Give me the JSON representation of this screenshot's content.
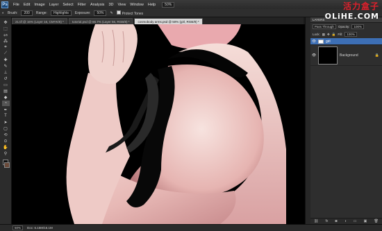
{
  "menu": {
    "logo": "Ps",
    "items": [
      "File",
      "Edit",
      "Image",
      "Layer",
      "Select",
      "Filter",
      "Analysis",
      "3D",
      "View",
      "Window",
      "Help"
    ],
    "zoom": "50%"
  },
  "options": {
    "brush_label": "Brush:",
    "brush_size": "200",
    "range_label": "Range:",
    "range_value": "Highlights",
    "exposure_label": "Exposure:",
    "exposure_value": "50%",
    "protect_tones": "Protect Tones"
  },
  "logo": {
    "cn": "活力盒子",
    "en": "OLiHE.COM"
  },
  "tabs": [
    "21.tif @ 16% (Layer 16, CMYK/8) *",
    "tutorial.psd @ 66.7% (Layer 56, RGB/8) *",
    "cosmobody arms.psd @ 50% (girl, RGB/8) *"
  ],
  "status": {
    "zoom": "50%",
    "doc": "Doc: 6.15M/16.1M"
  },
  "layers_panel": {
    "title": "LAYERS",
    "blend_mode": "Pass Through",
    "opacity_label": "Opacity:",
    "opacity_value": "100%",
    "lock_label": "Lock:",
    "fill_label": "Fill:",
    "fill_value": "100%",
    "layers": [
      {
        "name": "girl",
        "selected": true
      },
      {
        "name": "Background",
        "selected": false
      }
    ]
  }
}
